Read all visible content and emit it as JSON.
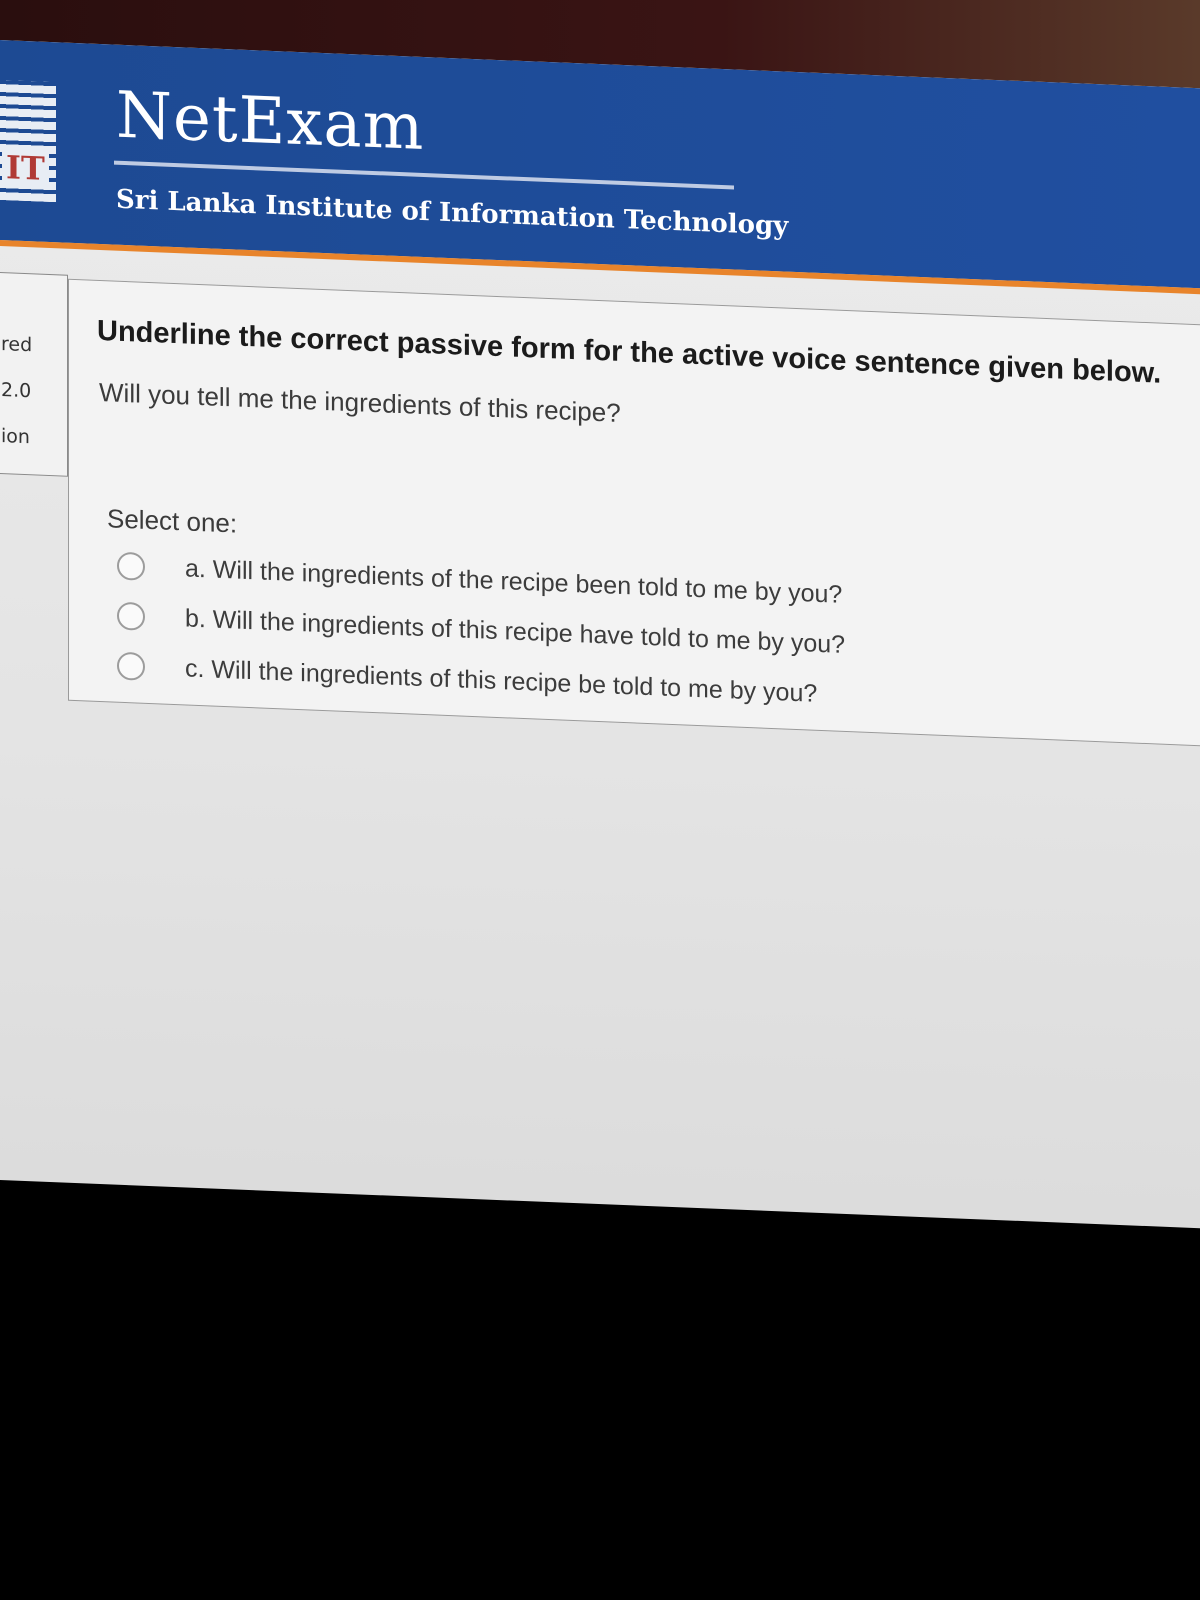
{
  "header": {
    "logo_text": "IT",
    "brand_title": "NetExam",
    "institution": "Sri Lanka Institute of Information Technology"
  },
  "sidebar": {
    "lines": [
      "red",
      "2.0",
      "ion"
    ]
  },
  "question": {
    "prompt": "Underline the correct passive form for the active voice sentence given below.",
    "sentence": "Will you tell me the ingredients of this recipe?",
    "select_label": "Select one:",
    "options": [
      {
        "label": "a. Will the ingredients of the recipe been told to me by you?",
        "selected": false
      },
      {
        "label": "b. Will the ingredients of this recipe have told to me by you?",
        "selected": false
      },
      {
        "label": "c. Will the ingredients of this recipe be told to me by you?",
        "selected": false
      }
    ]
  }
}
